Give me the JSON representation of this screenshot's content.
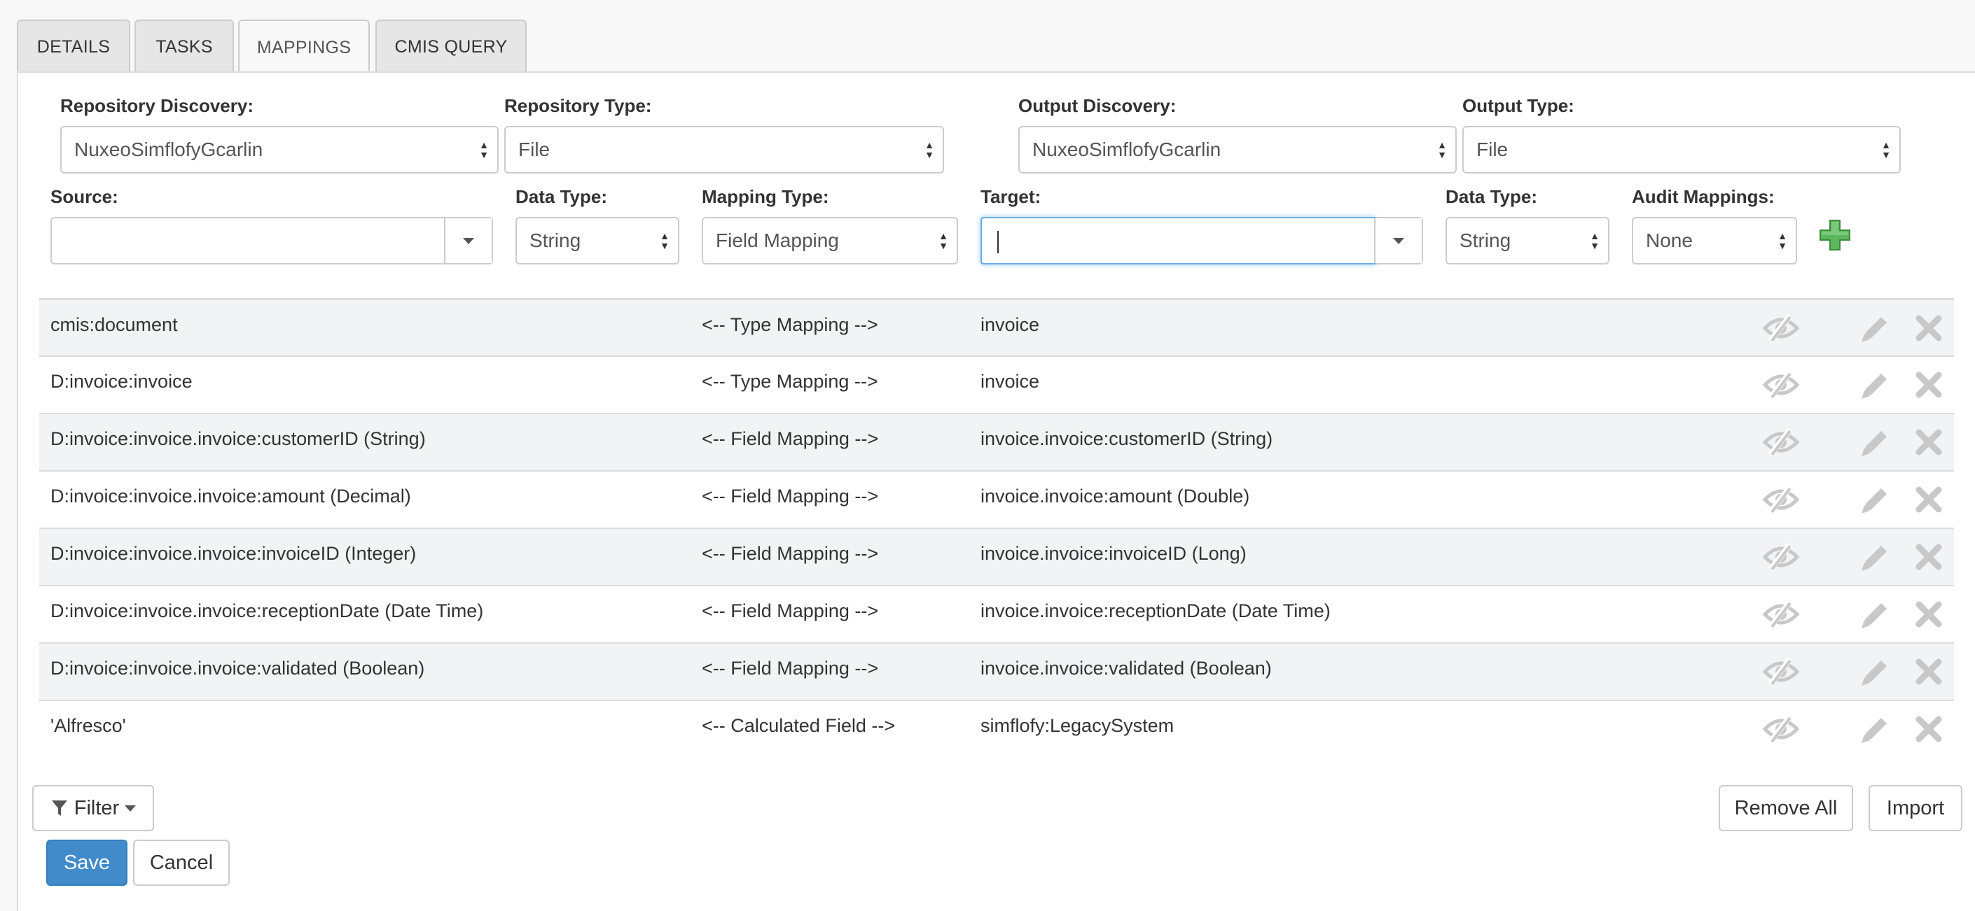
{
  "tabs": [
    {
      "label": "DETAILS"
    },
    {
      "label": "TASKS"
    },
    {
      "label": "MAPPINGS",
      "active": true
    },
    {
      "label": "CMIS QUERY"
    }
  ],
  "repository": {
    "discovery_label": "Repository Discovery:",
    "discovery_value": "NuxeoSimflofyGcarlin",
    "type_label": "Repository Type:",
    "type_value": "File"
  },
  "output": {
    "discovery_label": "Output Discovery:",
    "discovery_value": "NuxeoSimflofyGcarlin",
    "type_label": "Output Type:",
    "type_value": "File"
  },
  "mapping_form": {
    "source_label": "Source:",
    "source_value": "",
    "source_data_type_label": "Data Type:",
    "source_data_type_value": "String",
    "mapping_type_label": "Mapping Type:",
    "mapping_type_value": "Field Mapping",
    "target_label": "Target:",
    "target_value": "",
    "target_data_type_label": "Data Type:",
    "target_data_type_value": "String",
    "audit_label": "Audit Mappings:",
    "audit_value": "None"
  },
  "mappings": [
    {
      "source": "cmis:document",
      "type": "<-- Type Mapping -->",
      "target": "invoice"
    },
    {
      "source": "D:invoice:invoice",
      "type": "<-- Type Mapping -->",
      "target": "invoice"
    },
    {
      "source": "D:invoice:invoice.invoice:customerID (String)",
      "type": "<-- Field Mapping -->",
      "target": "invoice.invoice:customerID (String)"
    },
    {
      "source": "D:invoice:invoice.invoice:amount (Decimal)",
      "type": "<-- Field Mapping -->",
      "target": "invoice.invoice:amount (Double)"
    },
    {
      "source": "D:invoice:invoice.invoice:invoiceID (Integer)",
      "type": "<-- Field Mapping -->",
      "target": "invoice.invoice:invoiceID (Long)"
    },
    {
      "source": "D:invoice:invoice.invoice:receptionDate (Date Time)",
      "type": "<-- Field Mapping -->",
      "target": "invoice.invoice:receptionDate (Date Time)"
    },
    {
      "source": "D:invoice:invoice.invoice:validated (Boolean)",
      "type": "<-- Field Mapping -->",
      "target": "invoice.invoice:validated (Boolean)"
    },
    {
      "source": "'Alfresco'",
      "type": "<-- Calculated Field -->",
      "target": "simflofy:LegacySystem"
    }
  ],
  "footer": {
    "filter_label": "Filter",
    "remove_all_label": "Remove All",
    "import_label": "Import",
    "save_label": "Save",
    "cancel_label": "Cancel"
  },
  "colors": {
    "primary": "#428bca",
    "add": "#5cb85c",
    "icon_gray": "#c8c8c8",
    "focus": "#66afe9"
  },
  "icons": [
    "chevron-updown-icon",
    "caret-down-icon",
    "plus-icon",
    "eye-slash-icon",
    "pencil-icon",
    "times-icon",
    "filter-icon"
  ]
}
